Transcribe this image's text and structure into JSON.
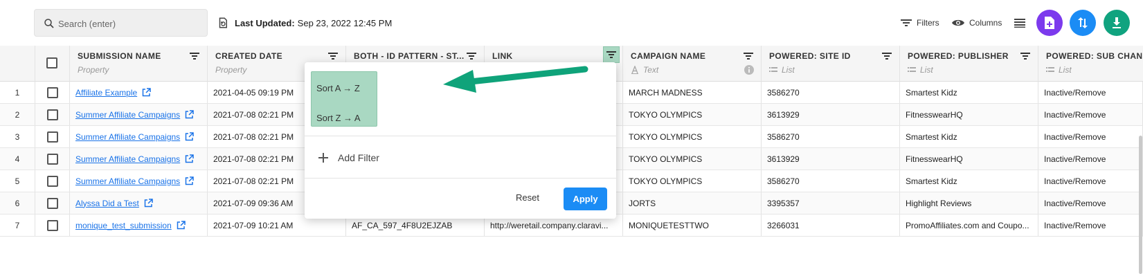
{
  "toolbar": {
    "search_placeholder": "Search (enter)",
    "last_updated_label": "Last Updated:",
    "last_updated_value": "Sep 23, 2022 12:45 PM",
    "filters_label": "Filters",
    "columns_label": "Columns",
    "circle_buttons": [
      {
        "icon": "add-document-icon",
        "color": "#7c3aed"
      },
      {
        "icon": "sort-arrows-icon",
        "color": "#1b8cf5"
      },
      {
        "icon": "download-icon",
        "color": "#10a37f"
      }
    ]
  },
  "columns": [
    {
      "title": "SUBMISSION NAME",
      "subtitle": "Property"
    },
    {
      "title": "CREATED DATE",
      "subtitle": "Property"
    },
    {
      "title": "BOTH - ID PATTERN - ST...",
      "subtitle": ""
    },
    {
      "title": "LINK",
      "subtitle": ""
    },
    {
      "title": "CAMPAIGN NAME",
      "subtitle": "Text"
    },
    {
      "title": "POWERED: SITE ID",
      "subtitle": "List"
    },
    {
      "title": "POWERED: PUBLISHER",
      "subtitle": "List"
    },
    {
      "title": "POWERED: SUB CHANN",
      "subtitle": "List"
    }
  ],
  "rows": [
    {
      "n": "1",
      "name": "Affiliate Example",
      "date": "2021-04-05 09:19 PM",
      "idp": "",
      "link": "",
      "campaign": "MARCH MADNESS",
      "site": "3586270",
      "publisher": "Smartest Kidz",
      "sub": "Inactive/Remove"
    },
    {
      "n": "2",
      "name": "Summer Affiliate Campaigns",
      "date": "2021-07-08 02:21 PM",
      "idp": "",
      "link": "",
      "campaign": "TOKYO OLYMPICS",
      "site": "3613929",
      "publisher": "FitnesswearHQ",
      "sub": "Inactive/Remove"
    },
    {
      "n": "3",
      "name": "Summer Affiliate Campaigns",
      "date": "2021-07-08 02:21 PM",
      "idp": "",
      "link": "",
      "campaign": "TOKYO OLYMPICS",
      "site": "3586270",
      "publisher": "Smartest Kidz",
      "sub": "Inactive/Remove"
    },
    {
      "n": "4",
      "name": "Summer Affiliate Campaigns",
      "date": "2021-07-08 02:21 PM",
      "idp": "",
      "link": "",
      "campaign": "TOKYO OLYMPICS",
      "site": "3613929",
      "publisher": "FitnesswearHQ",
      "sub": "Inactive/Remove"
    },
    {
      "n": "5",
      "name": "Summer Affiliate Campaigns",
      "date": "2021-07-08 02:21 PM",
      "idp": "",
      "link": "",
      "campaign": "TOKYO OLYMPICS",
      "site": "3586270",
      "publisher": "Smartest Kidz",
      "sub": "Inactive/Remove"
    },
    {
      "n": "6",
      "name": "Alyssa Did a Test",
      "date": "2021-07-09 09:36 AM",
      "idp": "",
      "link": "",
      "campaign": "JORTS",
      "site": "3395357",
      "publisher": "Highlight Reviews",
      "sub": "Inactive/Remove"
    },
    {
      "n": "7",
      "name": "monique_test_submission",
      "date": "2021-07-09 10:21 AM",
      "idp": "AF_CA_597_4F8U2EJZAB",
      "link": "http://weretail.company.claravi...",
      "campaign": "MONIQUETESTTWO",
      "site": "3266031",
      "publisher": "PromoAffiliates.com and Coupo...",
      "sub": "Inactive/Remove"
    }
  ],
  "popup": {
    "sort_asc": "Sort A → Z",
    "sort_desc": "Sort Z → A",
    "add_filter": "Add Filter",
    "reset": "Reset",
    "apply": "Apply"
  },
  "colors": {
    "accent": "#1b8cf5",
    "highlight": "#a9d8c2",
    "arrow": "#0fa37a",
    "link": "#1a73e8"
  }
}
